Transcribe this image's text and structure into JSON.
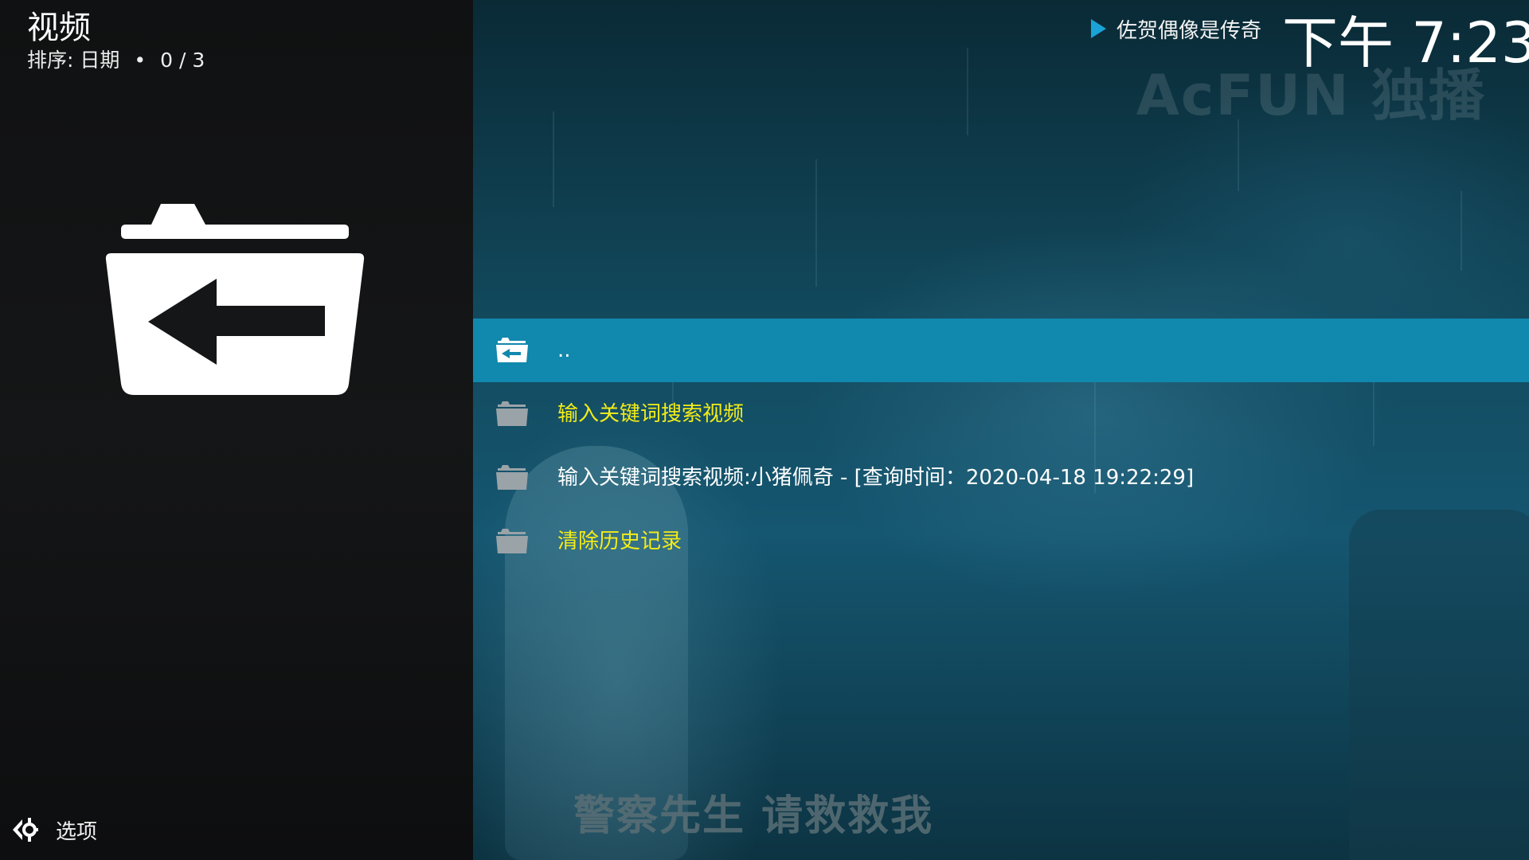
{
  "header": {
    "title": "视频",
    "sort_label": "排序: 日期",
    "dot": "•",
    "position": "0 / 3"
  },
  "now_playing": {
    "icon": "play-icon",
    "title": "佐贺偶像是传奇"
  },
  "clock": "下午 7:23",
  "background": {
    "watermark": "AcFUN 独播",
    "subtitle": "警察先生 请救救我"
  },
  "list": [
    {
      "label": "..",
      "icon": "folder-back-icon",
      "focused": true,
      "color": "#ffffff"
    },
    {
      "label": "输入关键词搜索视频",
      "icon": "folder-icon",
      "focused": false,
      "color": "#f3ec17"
    },
    {
      "label": "输入关键词搜索视频:小猪佩奇 - [查询时间：2020-04-18 19:22:29]",
      "icon": "folder-icon",
      "focused": false,
      "color": "#ffffff"
    },
    {
      "label": "清除历史记录",
      "icon": "folder-icon",
      "focused": false,
      "color": "#f3ec17"
    }
  ],
  "footer": {
    "options_label": "选项",
    "options_icon": "options-icon"
  },
  "colors": {
    "focus": "#1188ad",
    "highlight_text": "#f3ec17"
  }
}
